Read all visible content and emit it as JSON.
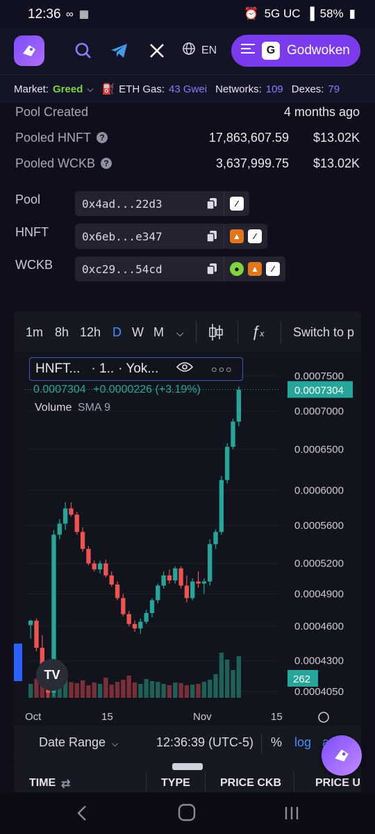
{
  "status_bar": {
    "time": "12:36",
    "network": "5G UC",
    "battery": "58%"
  },
  "header": {
    "language": "EN",
    "chain_button": "Godwoken",
    "icons": [
      "logo-icon",
      "search-icon",
      "telegram-icon",
      "x-icon",
      "globe-icon",
      "menu-icon"
    ]
  },
  "ticker": {
    "market_label": "Market:",
    "market_value": "Greed",
    "gas_label": "ETH Gas:",
    "gas_value": "43 Gwei",
    "networks_label": "Networks:",
    "networks_value": "109",
    "dexes_label": "Dexes:",
    "dexes_value": "79"
  },
  "pool_stats": [
    {
      "label": "Pool Created",
      "value": "4 months ago"
    },
    {
      "label": "Pooled HNFT",
      "amount": "17,863,607.59",
      "usd": "$13.02K"
    },
    {
      "label": "Pooled WCKB",
      "amount": "3,637,999.75",
      "usd": "$13.02K"
    }
  ],
  "addresses": [
    {
      "label": "Pool",
      "address": "0x4ad...22d3"
    },
    {
      "label": "HNFT",
      "address": "0x6eb...e347"
    },
    {
      "label": "WCKB",
      "address": "0xc29...54cd"
    }
  ],
  "chart_toolbar": {
    "timeframes": [
      "1m",
      "8h",
      "12h",
      "D",
      "W",
      "M"
    ],
    "active": "D",
    "switch_label": "Switch to p"
  },
  "chart_legend": {
    "symbol": "HNFT...",
    "interval": "· 1..",
    "exchange": "· Yok...",
    "price": "0.0007304",
    "change": "+0.0000226 (+3.19%)",
    "volume_label": "Volume",
    "sma_label": "SMA 9"
  },
  "chart_data": {
    "type": "candlestick",
    "x_ticks": [
      "Oct",
      "15",
      "Nov",
      "15"
    ],
    "y_ticks": [
      "0.0007500",
      "0.0007000",
      "0.0006500",
      "0.0006000",
      "0.0005600",
      "0.0005200",
      "0.0004900",
      "0.0004600",
      "0.0004300",
      "0.0004050"
    ],
    "last_price_label": "0.0007304",
    "volume_label": "262",
    "scale": "log",
    "candles": [
      {
        "o": 0.000461,
        "h": 0.000466,
        "l": 0.000449,
        "c": 0.000465
      },
      {
        "o": 0.000465,
        "h": 0.000467,
        "l": 0.000438,
        "c": 0.000441
      },
      {
        "o": 0.000441,
        "h": 0.000452,
        "l": 0.000415,
        "c": 0.000418
      },
      {
        "o": 0.000418,
        "h": 0.000424,
        "l": 0.0004,
        "c": 0.000404
      },
      {
        "o": 0.000404,
        "h": 0.000555,
        "l": 0.000401,
        "c": 0.00055
      },
      {
        "o": 0.00055,
        "h": 0.000567,
        "l": 0.000545,
        "c": 0.000562
      },
      {
        "o": 0.000562,
        "h": 0.000586,
        "l": 0.000555,
        "c": 0.000579
      },
      {
        "o": 0.000579,
        "h": 0.000586,
        "l": 0.00057,
        "c": 0.000572
      },
      {
        "o": 0.000572,
        "h": 0.000575,
        "l": 0.00055,
        "c": 0.000553
      },
      {
        "o": 0.000553,
        "h": 0.000558,
        "l": 0.000532,
        "c": 0.000535
      },
      {
        "o": 0.000535,
        "h": 0.000538,
        "l": 0.000518,
        "c": 0.00052
      },
      {
        "o": 0.00052,
        "h": 0.000523,
        "l": 0.000512,
        "c": 0.000514
      },
      {
        "o": 0.000514,
        "h": 0.000523,
        "l": 0.00051,
        "c": 0.00052
      },
      {
        "o": 0.00052,
        "h": 0.000524,
        "l": 0.000506,
        "c": 0.000508
      },
      {
        "o": 0.000508,
        "h": 0.000512,
        "l": 0.000497,
        "c": 0.000499
      },
      {
        "o": 0.000499,
        "h": 0.000502,
        "l": 0.000484,
        "c": 0.000486
      },
      {
        "o": 0.000486,
        "h": 0.00049,
        "l": 0.000469,
        "c": 0.000471
      },
      {
        "o": 0.000471,
        "h": 0.000474,
        "l": 0.00046,
        "c": 0.000462
      },
      {
        "o": 0.000462,
        "h": 0.000465,
        "l": 0.000455,
        "c": 0.000458
      },
      {
        "o": 0.000458,
        "h": 0.000467,
        "l": 0.000453,
        "c": 0.000464
      },
      {
        "o": 0.000464,
        "h": 0.000475,
        "l": 0.000462,
        "c": 0.000472
      },
      {
        "o": 0.000472,
        "h": 0.000486,
        "l": 0.000468,
        "c": 0.000484
      },
      {
        "o": 0.000484,
        "h": 0.0005,
        "l": 0.000481,
        "c": 0.000498
      },
      {
        "o": 0.000498,
        "h": 0.000512,
        "l": 0.000495,
        "c": 0.000508
      },
      {
        "o": 0.000508,
        "h": 0.000514,
        "l": 0.0005,
        "c": 0.000503
      },
      {
        "o": 0.000503,
        "h": 0.000517,
        "l": 0.0005,
        "c": 0.000515
      },
      {
        "o": 0.000515,
        "h": 0.000517,
        "l": 0.000495,
        "c": 0.000498
      },
      {
        "o": 0.000498,
        "h": 0.000508,
        "l": 0.000482,
        "c": 0.000486
      },
      {
        "o": 0.000486,
        "h": 0.000505,
        "l": 0.000484,
        "c": 0.000502
      },
      {
        "o": 0.000502,
        "h": 0.000512,
        "l": 0.000496,
        "c": 0.0005
      },
      {
        "o": 0.0005,
        "h": 0.000505,
        "l": 0.00049,
        "c": 0.000502
      },
      {
        "o": 0.000502,
        "h": 0.000545,
        "l": 0.000498,
        "c": 0.00054
      },
      {
        "o": 0.00054,
        "h": 0.000556,
        "l": 0.000535,
        "c": 0.000553
      },
      {
        "o": 0.000553,
        "h": 0.000617,
        "l": 0.00055,
        "c": 0.000612
      },
      {
        "o": 0.000612,
        "h": 0.000658,
        "l": 0.000608,
        "c": 0.000653
      },
      {
        "o": 0.000653,
        "h": 0.00069,
        "l": 0.00065,
        "c": 0.000686
      },
      {
        "o": 0.000686,
        "h": 0.000735,
        "l": 0.00068,
        "c": 0.00073
      }
    ],
    "volumes": [
      40,
      55,
      38,
      30,
      48,
      60,
      52,
      45,
      42,
      50,
      36,
      44,
      40,
      58,
      38,
      46,
      52,
      64,
      44,
      40,
      54,
      48,
      46,
      40,
      36,
      44,
      42,
      36,
      38,
      40,
      46,
      52,
      68,
      130,
      110,
      80,
      120
    ]
  },
  "chart_bottom": {
    "date_range": "Date Range",
    "clock": "12:36:39 (UTC-5)",
    "percent": "%",
    "log": "log",
    "auto": "a"
  },
  "table": {
    "columns": [
      "TIME",
      "TYPE",
      "PRICE CKB",
      "PRICE U"
    ]
  }
}
